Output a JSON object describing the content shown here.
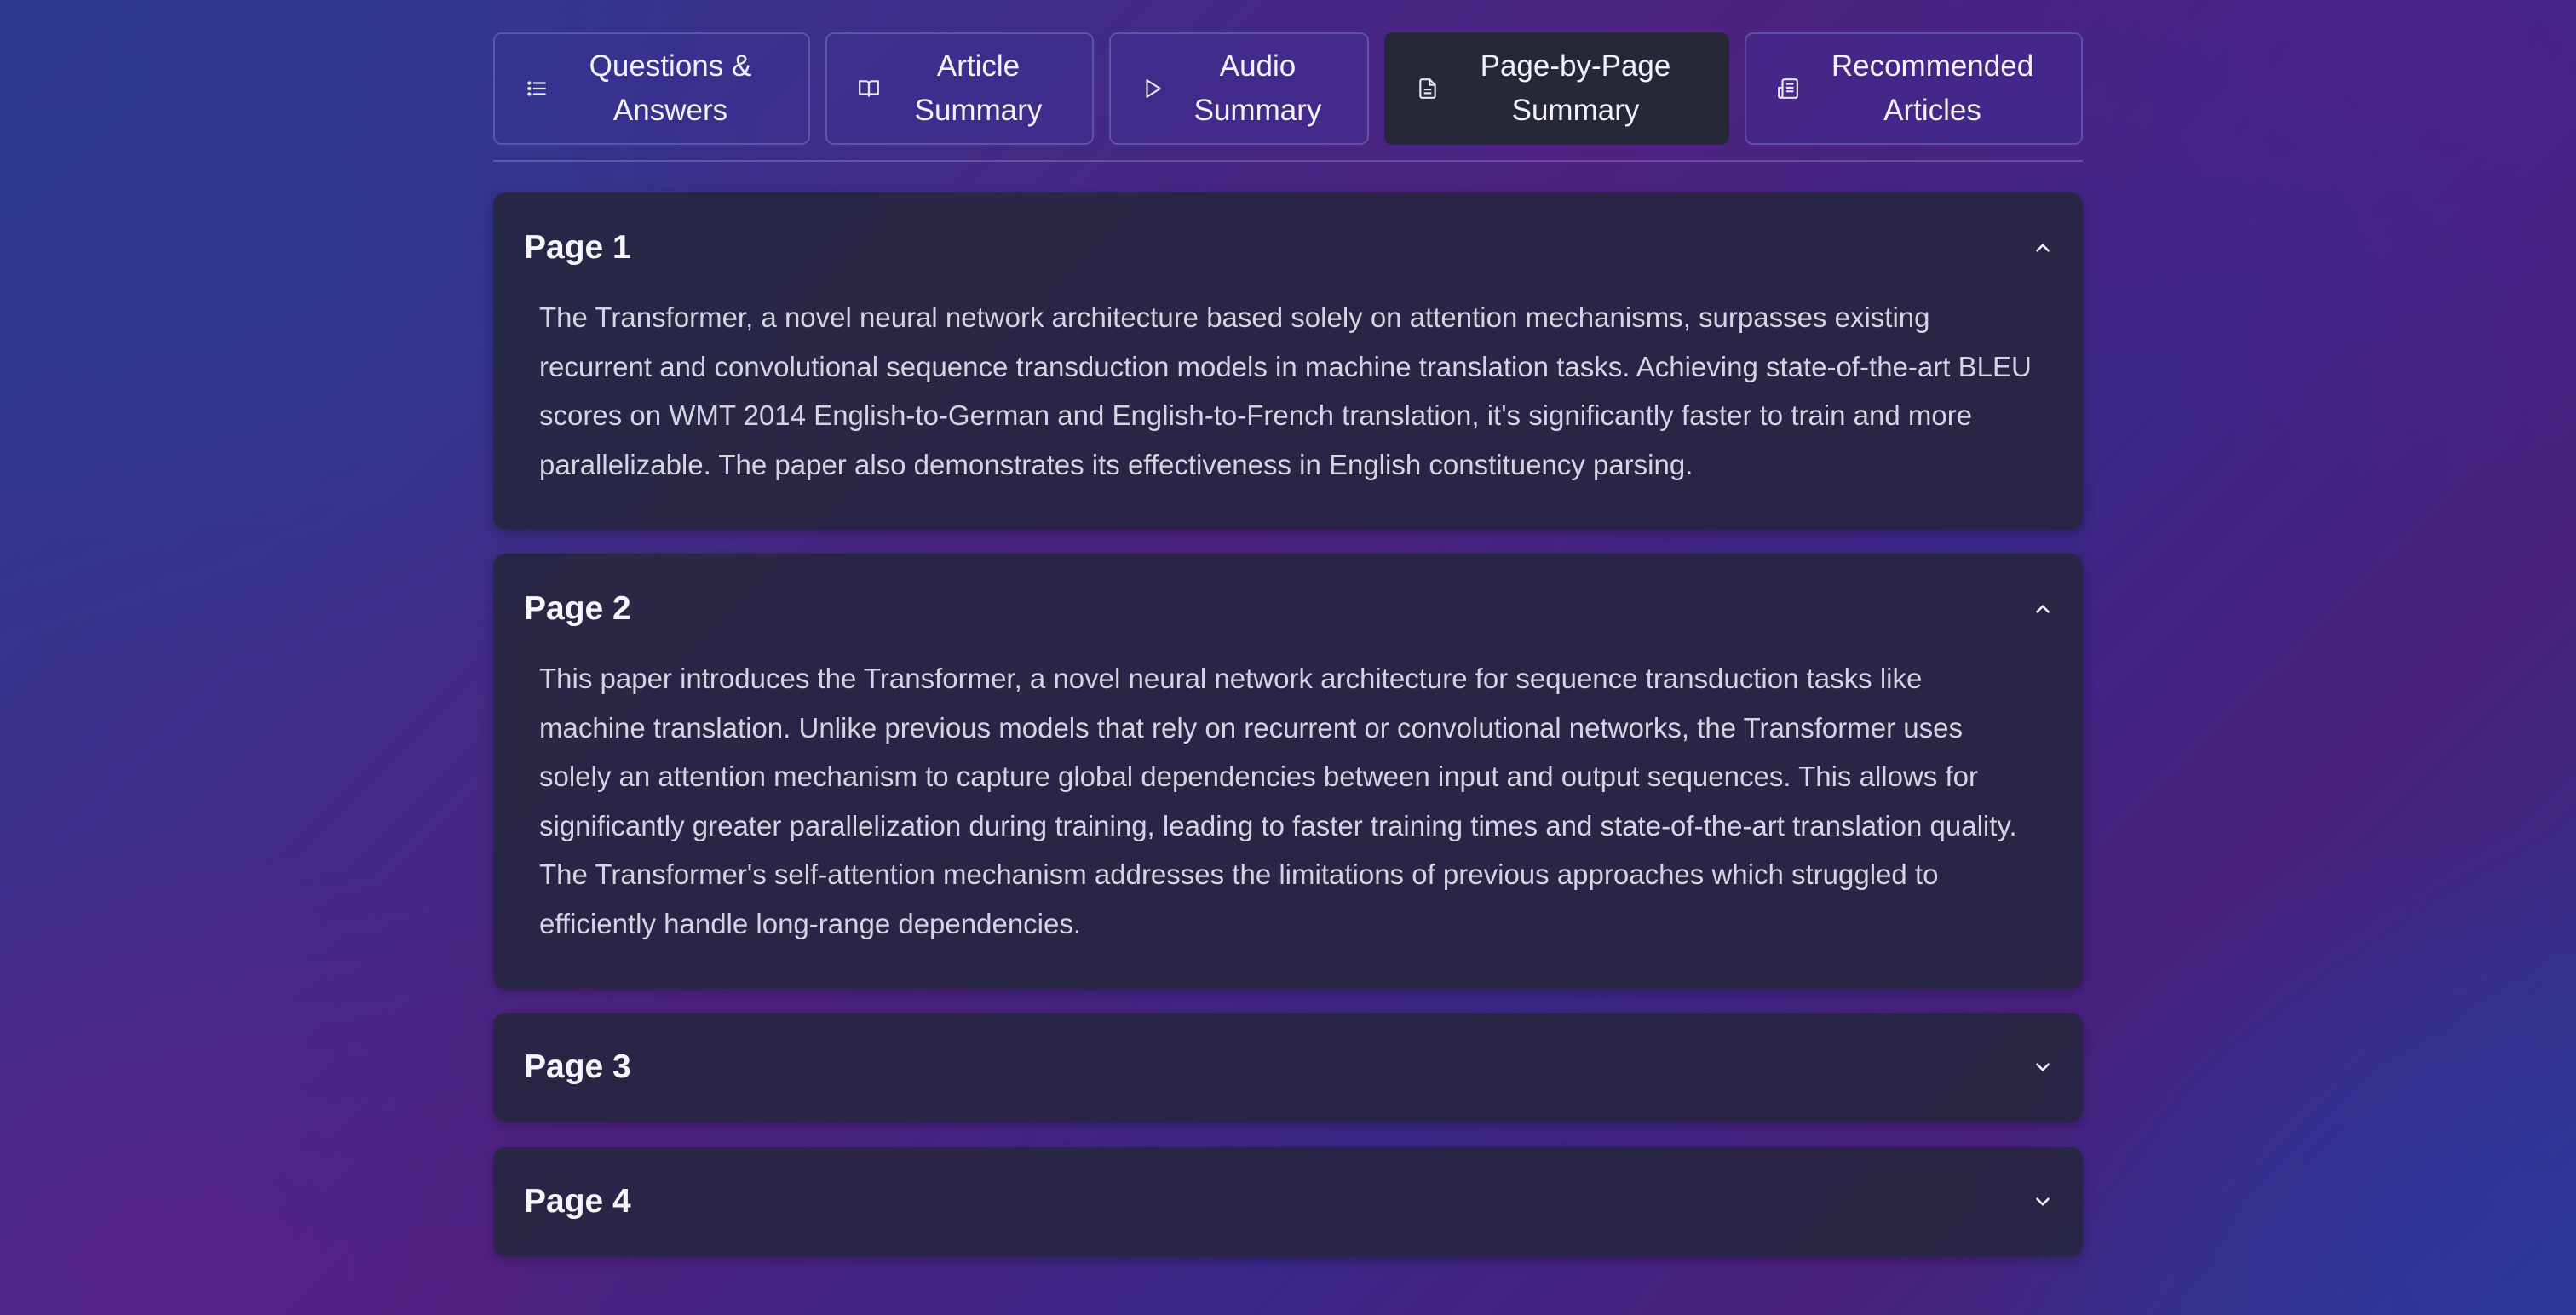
{
  "tabs": [
    {
      "label": "Questions & Answers",
      "icon": "list-icon",
      "active": false
    },
    {
      "label": "Article Summary",
      "icon": "book-icon",
      "active": false
    },
    {
      "label": "Audio Summary",
      "icon": "play-icon",
      "active": false
    },
    {
      "label": "Page-by-Page Summary",
      "icon": "document-icon",
      "active": true
    },
    {
      "label": "Recommended Articles",
      "icon": "newspaper-icon",
      "active": false
    }
  ],
  "pages": [
    {
      "title": "Page 1",
      "expanded": true,
      "summary": "The Transformer, a novel neural network architecture based solely on attention mechanisms, surpasses existing recurrent and convolutional sequence transduction models in machine translation tasks. Achieving state-of-the-art BLEU scores on WMT 2014 English-to-German and English-to-French translation, it's significantly faster to train and more parallelizable. The paper also demonstrates its effectiveness in English constituency parsing."
    },
    {
      "title": "Page 2",
      "expanded": true,
      "summary": "This paper introduces the Transformer, a novel neural network architecture for sequence transduction tasks like machine translation. Unlike previous models that rely on recurrent or convolutional networks, the Transformer uses solely an attention mechanism to capture global dependencies between input and output sequences. This allows for significantly greater parallelization during training, leading to faster training times and state-of-the-art translation quality. The Transformer's self-attention mechanism addresses the limitations of previous approaches which struggled to efficiently handle long-range dependencies."
    },
    {
      "title": "Page 3",
      "expanded": false
    },
    {
      "title": "Page 4",
      "expanded": false
    }
  ],
  "colors": {
    "active_tab": "#262838",
    "panel": "#26263e"
  }
}
